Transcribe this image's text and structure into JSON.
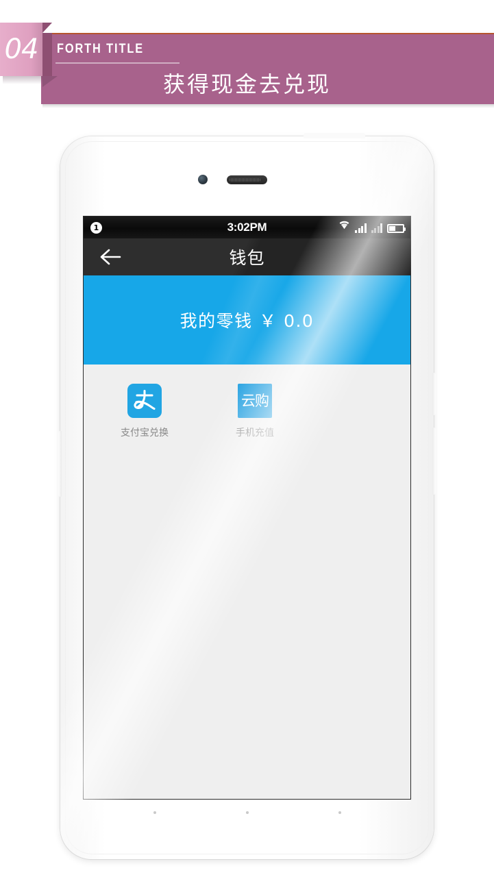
{
  "header": {
    "number_tab": "04",
    "eyebrow": "FORTH TITLE",
    "title": "获得现金去兑现",
    "banner_color": "#a8628c",
    "tab_color": "#dfa0c0",
    "rule_color": "#b6552f"
  },
  "phone": {
    "status_bar": {
      "badge": "1",
      "time": "3:02PM",
      "wifi_icon": "wifi-icon",
      "signal_icon_1": "signal-bars-icon",
      "signal_icon_2": "signal-bars-icon",
      "battery_icon": "battery-icon",
      "battery_percent": 45
    },
    "title_bar": {
      "back_icon": "back-arrow-icon",
      "title": "钱包"
    },
    "balance": {
      "label": "我的零钱",
      "currency": "￥",
      "amount": "0.0",
      "full_text": "我的零钱  ￥ 0.0",
      "bg_color": "#17a7e8"
    },
    "apps": [
      {
        "icon_name": "alipay-icon",
        "icon_glyph": "支",
        "label": "支付宝兑换",
        "icon_color": "#21a5e3"
      },
      {
        "icon_name": "yungou-icon",
        "icon_glyph": "云购",
        "label": "手机充值",
        "icon_color": "#1e9ee0"
      }
    ],
    "nav_dots": 3,
    "content_bg": "#efefef"
  }
}
